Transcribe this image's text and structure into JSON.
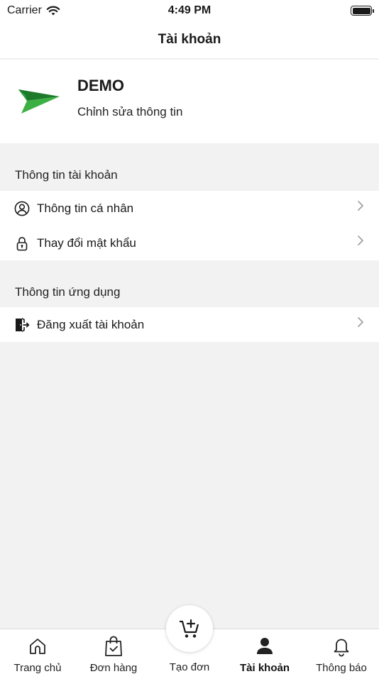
{
  "status_bar": {
    "carrier": "Carrier",
    "time": "4:49 PM"
  },
  "nav": {
    "title": "Tài khoản"
  },
  "profile": {
    "name": "DEMO",
    "edit_label": "Chỉnh sửa thông tin",
    "logo_color": "#2e9b3a"
  },
  "sections": [
    {
      "header": "Thông tin tài khoản",
      "items": [
        {
          "label": "Thông tin cá nhân",
          "icon": "user-circle-icon"
        },
        {
          "label": "Thay đổi mật khẩu",
          "icon": "lock-icon"
        }
      ]
    },
    {
      "header": "Thông tin ứng dụng",
      "items": [
        {
          "label": "Đăng xuất tài khoản",
          "icon": "logout-icon"
        }
      ]
    }
  ],
  "tabs": [
    {
      "label": "Trang chủ",
      "icon": "home-icon",
      "active": false
    },
    {
      "label": "Đơn hàng",
      "icon": "shopping-bag-check-icon",
      "active": false
    },
    {
      "label": "Tạo đơn",
      "icon": "cart-plus-icon",
      "active": false
    },
    {
      "label": "Tài khoản",
      "icon": "person-icon",
      "active": true
    },
    {
      "label": "Thông báo",
      "icon": "bell-icon",
      "active": false
    }
  ]
}
